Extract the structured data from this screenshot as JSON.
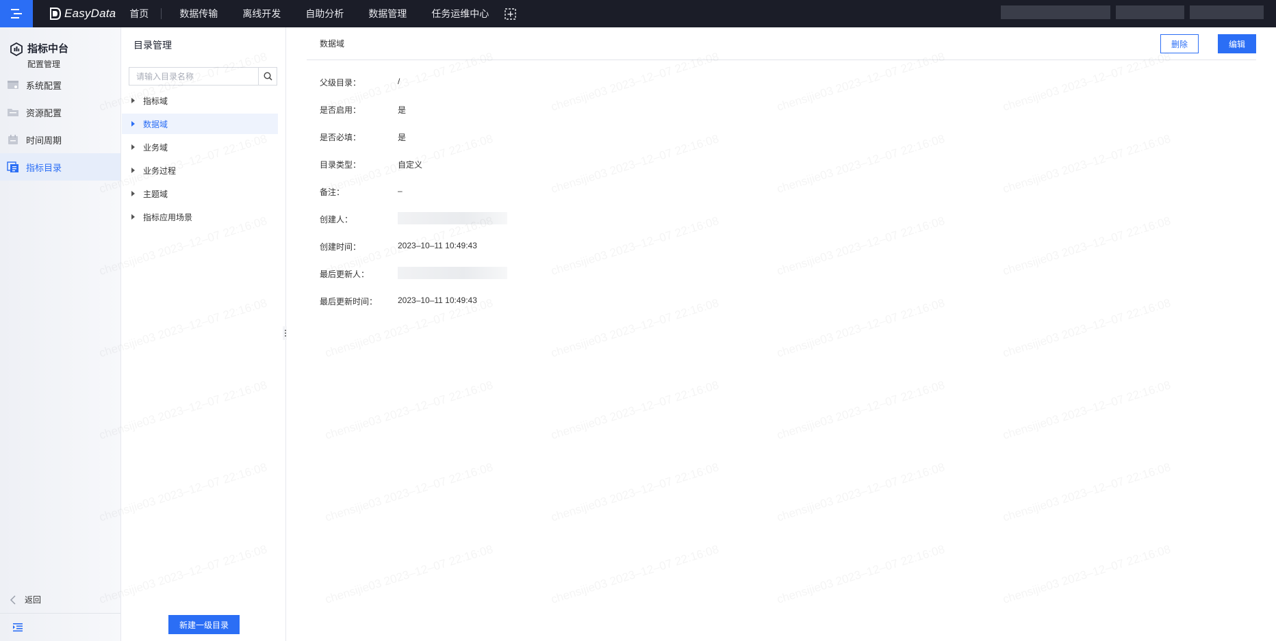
{
  "topbar": {
    "logo_text": "EasyData",
    "nav": [
      "首页",
      "数据传输",
      "离线开发",
      "自助分析",
      "数据管理",
      "任务运维中心"
    ]
  },
  "sidebar": {
    "title": "指标中台",
    "subtitle": "配置管理",
    "items": [
      {
        "label": "系统配置",
        "icon": "system-config-icon",
        "active": false
      },
      {
        "label": "资源配置",
        "icon": "folder-icon",
        "active": false
      },
      {
        "label": "时间周期",
        "icon": "calendar-icon",
        "active": false
      },
      {
        "label": "指标目录",
        "icon": "catalog-icon",
        "active": true
      }
    ],
    "back_label": "返回"
  },
  "catalog": {
    "title": "目录管理",
    "search_placeholder": "请输入目录名称",
    "tree": [
      {
        "label": "指标域",
        "active": false
      },
      {
        "label": "数据域",
        "active": true
      },
      {
        "label": "业务域",
        "active": false
      },
      {
        "label": "业务过程",
        "active": false
      },
      {
        "label": "主题域",
        "active": false
      },
      {
        "label": "指标应用场景",
        "active": false
      }
    ],
    "new_button": "新建一级目录"
  },
  "detail": {
    "title": "数据域",
    "delete_label": "删除",
    "edit_label": "编辑",
    "fields": [
      {
        "label": "父级目录：",
        "value": "/"
      },
      {
        "label": "是否启用：",
        "value": "是"
      },
      {
        "label": "是否必填：",
        "value": "是"
      },
      {
        "label": "目录类型：",
        "value": "自定义"
      },
      {
        "label": "备注：",
        "value": "–"
      },
      {
        "label": "创建人：",
        "value": ""
      },
      {
        "label": "创建时间：",
        "value": "2023–10–11 10:49:43"
      },
      {
        "label": "最后更新人：",
        "value": ""
      },
      {
        "label": "最后更新时间：",
        "value": "2023–10–11 10:49:43"
      }
    ]
  },
  "watermark": "chensijie03 2023–12–07 22:16:08",
  "colors": {
    "primary": "#2b6ef5",
    "topbar": "#1b1d28"
  }
}
